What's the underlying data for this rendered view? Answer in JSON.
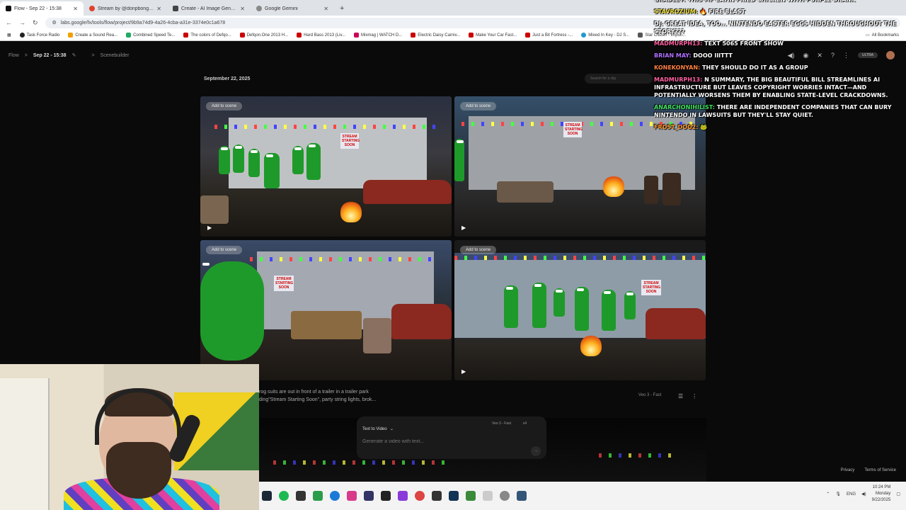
{
  "browser": {
    "tabs": [
      {
        "label": "Flow - Sep 22 - 15:38",
        "color": "#111111"
      },
      {
        "label": "Stream by @donpbongwater |",
        "color": "#e0422e"
      },
      {
        "label": "Create - AI Image Generator |",
        "color": "#444444"
      },
      {
        "label": "Google Gemini",
        "color": "#888888"
      }
    ],
    "new_tab": "+",
    "url": "labs.google/fx/tools/flow/project/9b9a74d9-4a26-4cba-a31e-3374e0c1a678",
    "bookmarks": [
      "Task Force Radio",
      "Create a Sound Rea...",
      "Combined Speed Te...",
      "The colors of Defqo...",
      "Defqon.One 2013 H...",
      "Hard Bass 2013 (Liv...",
      "Mixmag | WATCH D...",
      "Electric Daisy Carniv...",
      "Make Your Car Fast...",
      "Just a Bit Fortress -...",
      "Mixed In Key - DJ S...",
      "Star Citizen - Impun..."
    ],
    "all_bookmarks": "All Bookmarks"
  },
  "app": {
    "breadcrumb_root": "Flow",
    "breadcrumb_sep": ">",
    "project_title": "Sep 22 - 15:38",
    "breadcrumb_page": "Scenebuilder",
    "ultra_badge": "ULTRA",
    "date_heading": "September 22, 2025",
    "search_placeholder": "Search for a clip",
    "add_to_scene": "Add to scene",
    "prompt_line1": "rog suits are out in front of a trailer in a trailer park",
    "prompt_line2": "ding\"Stream Starting Soon\", party string lights, brok...",
    "model_label": "Veo 3 - Fast",
    "composer": {
      "mode": "Text to Video",
      "model": "Veo 3 - Fast",
      "count": "x4",
      "placeholder": "Generate a video with text..."
    },
    "footer": {
      "privacy": "Privacy",
      "terms": "Terms of Service"
    },
    "tiles": [
      {
        "sign": "STREAM STARTING SOON"
      },
      {
        "sign": "STREAM STARTING SOON"
      },
      {
        "sign": "STREAM STARTING SOON"
      },
      {
        "sign": "STREAM STARTING SOON"
      }
    ]
  },
  "chat": [
    {
      "user": "Gradley:",
      "user_color": "#e8e8e8",
      "body": "this mf eatin fried chicken with purple drank"
    },
    {
      "user": "Stavrozium:",
      "user_color": "#f0e040",
      "body": "🔥 fire blast"
    },
    {
      "user": "DJ:",
      "user_color": "#ffffff",
      "body": "great idea, too... nintendo easter eggs hidden throughout the story???"
    },
    {
      "user": "madmurph13:",
      "user_color": "#ff5fa0",
      "body": "text 5065 front show"
    },
    {
      "user": "Brian May:",
      "user_color": "#b070ff",
      "body": "dooo iiittt"
    },
    {
      "user": "Konekonyan:",
      "user_color": "#ff8040",
      "body": "they should do it as a group"
    },
    {
      "user": "madmurph13:",
      "user_color": "#ff5fa0",
      "body": "n summary, the Big Beautiful Bill streamlines AI infrastructure but leaves copyright worries intact—and potentially worsens them by enabling state-level crackdowns."
    },
    {
      "user": "AnarchoNihilist:",
      "user_color": "#40e060",
      "body": "there are independent companies that can bury Nintendo in lawsuits but they'll stay quiet."
    },
    {
      "user": "Frost_Dog2:",
      "user_color": "#ff9a30",
      "body": "🐸"
    }
  ],
  "taskbar": {
    "lang": "ENG",
    "time": "10:24 PM",
    "day": "Monday",
    "date": "9/22/2025"
  }
}
